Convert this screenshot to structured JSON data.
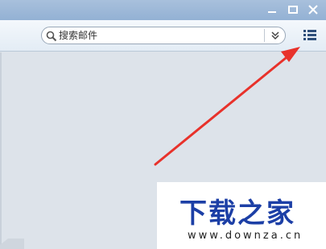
{
  "window": {
    "controls": [
      "minimize-icon",
      "maximize-icon",
      "close-icon"
    ]
  },
  "search": {
    "placeholder": "搜索邮件",
    "icon": "search-icon",
    "dropdown_icon": "double-chevron-down-icon"
  },
  "toolbar": {
    "menu_icon": "list-menu-icon"
  },
  "annotation": {
    "arrow_color": "#e8322b"
  },
  "watermark": {
    "title": "下载之家",
    "url": "www.downza.cn",
    "color": "#1c3fa6"
  }
}
